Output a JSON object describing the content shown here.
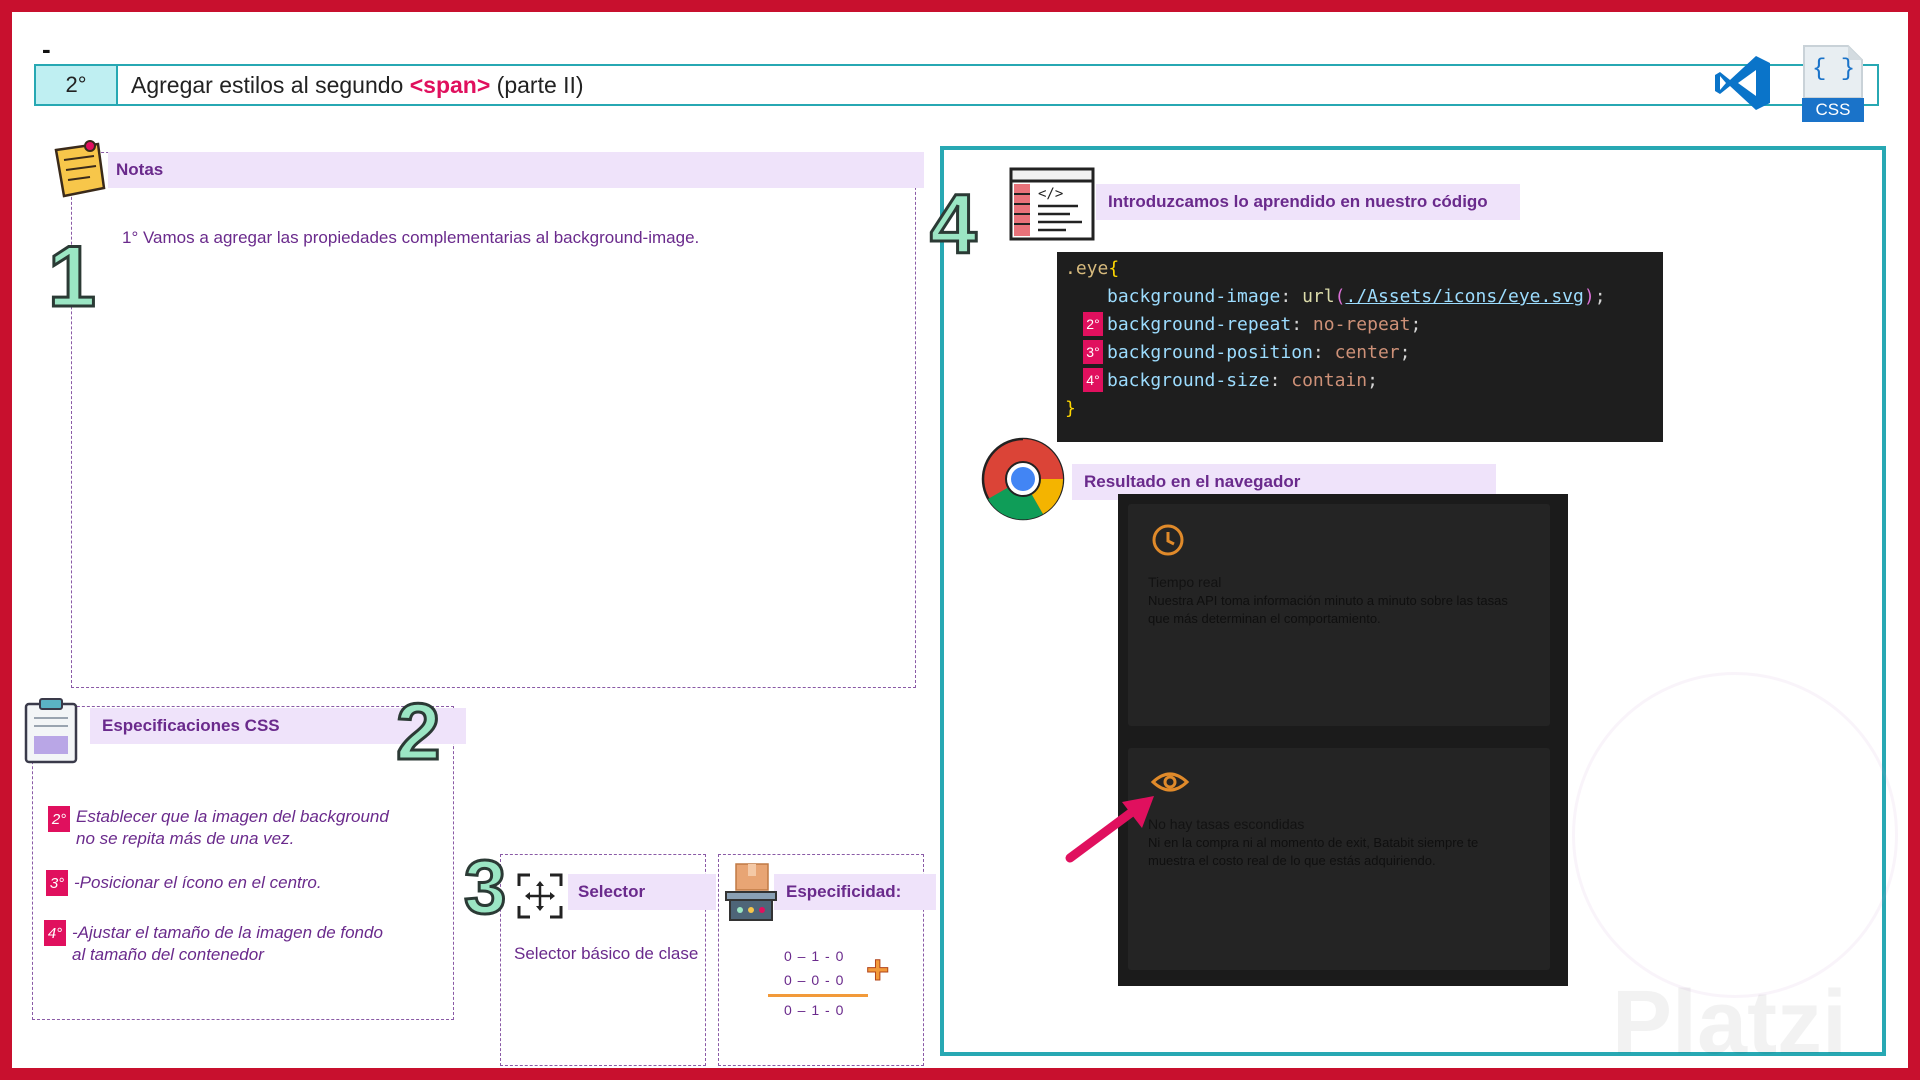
{
  "slide": {
    "dash": "-",
    "step": "2°",
    "title_before": "Agregar estilos al segundo ",
    "title_tag": "<span>",
    "title_after": " (parte II)",
    "css_file_label": "CSS",
    "css_file_braces": "{ }"
  },
  "notes": {
    "header": "Notas",
    "number": "1",
    "line": "1° Vamos a agregar las propiedades complementarias al background-image."
  },
  "specs": {
    "header": "Especificaciones CSS",
    "number": "2",
    "items": [
      {
        "badge": "2°",
        "text1": "Establecer que la imagen del background",
        "text2": "no se repita más de una vez."
      },
      {
        "badge": "3°",
        "text1": "-Posicionar el ícono en el centro.",
        "text2": ""
      },
      {
        "badge": "4°",
        "text1": "-Ajustar el tamaño de la imagen de fondo",
        "text2": "al tamaño del contenedor"
      }
    ]
  },
  "selector": {
    "number": "3",
    "header": "Selector",
    "text": "Selector básico de clase"
  },
  "specificity": {
    "header": "Especificidad:",
    "row1": "0 – 1 - 0",
    "row2": "0 – 0 - 0",
    "row3": "0 – 1 - 0",
    "plus": "+"
  },
  "code_section": {
    "number": "4",
    "header": "Introduzcamos lo aprendido en nuestro código",
    "selector": ".eye",
    "open": "{",
    "close": "}",
    "lines": [
      {
        "badge": "",
        "prop": "background-image",
        "fn": "url",
        "url": "./Assets/icons/eye.svg",
        "val": ""
      },
      {
        "badge": "2°",
        "prop": "background-repeat",
        "val": "no-repeat"
      },
      {
        "badge": "3°",
        "prop": "background-position",
        "val": "center"
      },
      {
        "badge": "4°",
        "prop": "background-size",
        "val": "contain"
      }
    ]
  },
  "result": {
    "header": "Resultado en el navegador",
    "card1_title": "Tiempo real",
    "card1_text": "Nuestra API toma información minuto a minuto sobre las tasas que más determinan el comportamiento.",
    "card2_title": "No hay tasas escondidas",
    "card2_text": "Ni en la compra ni al momento de exit, Batabit siempre te muestra el costo real de lo que estás adquiriendo."
  },
  "colors": {
    "frame": "#c8102e",
    "teal": "#27a8b3",
    "purple_text": "#6a2a8c",
    "pink": "#e0105e",
    "icon_orange": "#e08a2a"
  },
  "icons": [
    "vscode-icon",
    "css-file-icon",
    "sticky-note-icon",
    "clipboard-icon",
    "selector-move-icon",
    "scale-icon",
    "code-window-icon",
    "chrome-icon",
    "clock-icon",
    "eye-icon",
    "arrow-icon"
  ]
}
